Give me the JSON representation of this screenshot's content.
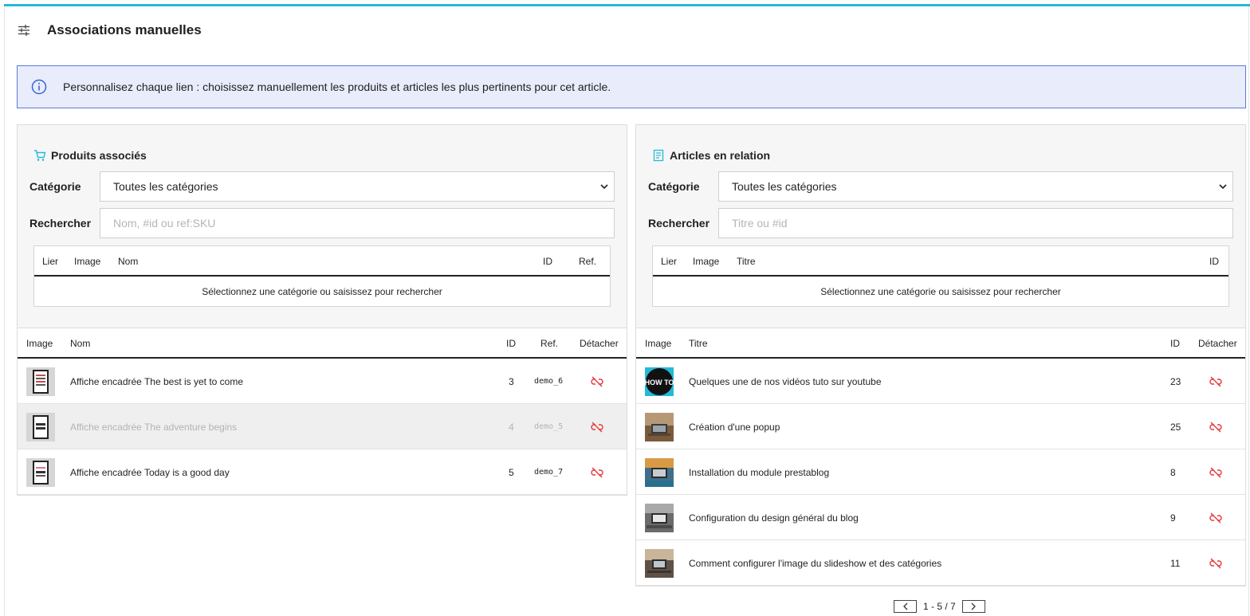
{
  "header": {
    "title": "Associations manuelles",
    "icon": "sliders-icon"
  },
  "info_alert": {
    "text": "Personnalisez chaque lien : choisissez manuellement les produits et articles les plus pertinents pour cet article.",
    "icon": "info-icon"
  },
  "products_panel": {
    "title": "Produits associés",
    "icon": "cart-icon",
    "category_label": "Catégorie",
    "category_value": "Toutes les catégories",
    "search_label": "Rechercher",
    "search_placeholder": "Nom, #id ou ref:SKU",
    "search_columns": {
      "link": "Lier",
      "image": "Image",
      "name": "Nom",
      "id": "ID",
      "ref": "Ref."
    },
    "empty_message": "Sélectionnez une catégorie ou saisissez pour rechercher",
    "list_columns": {
      "image": "Image",
      "name": "Nom",
      "id": "ID",
      "ref": "Ref.",
      "detach": "Détacher"
    },
    "rows": [
      {
        "name": "Affiche encadrée The best is yet to come",
        "id": "3",
        "ref": "demo_6",
        "active": true
      },
      {
        "name": "Affiche encadrée The adventure begins",
        "id": "4",
        "ref": "demo_5",
        "active": false
      },
      {
        "name": "Affiche encadrée Today is a good day",
        "id": "5",
        "ref": "demo_7",
        "active": true
      }
    ]
  },
  "articles_panel": {
    "title": "Articles en relation",
    "icon": "document-icon",
    "category_label": "Catégorie",
    "category_value": "Toutes les catégories",
    "search_label": "Rechercher",
    "search_placeholder": "Titre ou #id",
    "search_columns": {
      "link": "Lier",
      "image": "Image",
      "title": "Titre",
      "id": "ID"
    },
    "empty_message": "Sélectionnez une catégorie ou saisissez pour rechercher",
    "list_columns": {
      "image": "Image",
      "title": "Titre",
      "id": "ID",
      "detach": "Détacher"
    },
    "rows": [
      {
        "title": "Quelques une de nos vidéos tuto sur youtube",
        "id": "23",
        "thumb_text": "HOW TO"
      },
      {
        "title": "Création d'une popup",
        "id": "25"
      },
      {
        "title": "Installation du module prestablog",
        "id": "8"
      },
      {
        "title": "Configuration du design général du blog",
        "id": "9"
      },
      {
        "title": "Comment configurer l'image du slideshow et des catégories",
        "id": "11"
      }
    ],
    "pagination": {
      "text": "1 - 5 / 7"
    }
  },
  "colors": {
    "accent": "#25b9d7",
    "alert_bg": "#e8ecfb",
    "alert_border": "#5b7bd5",
    "unlink": "#e5383b"
  }
}
